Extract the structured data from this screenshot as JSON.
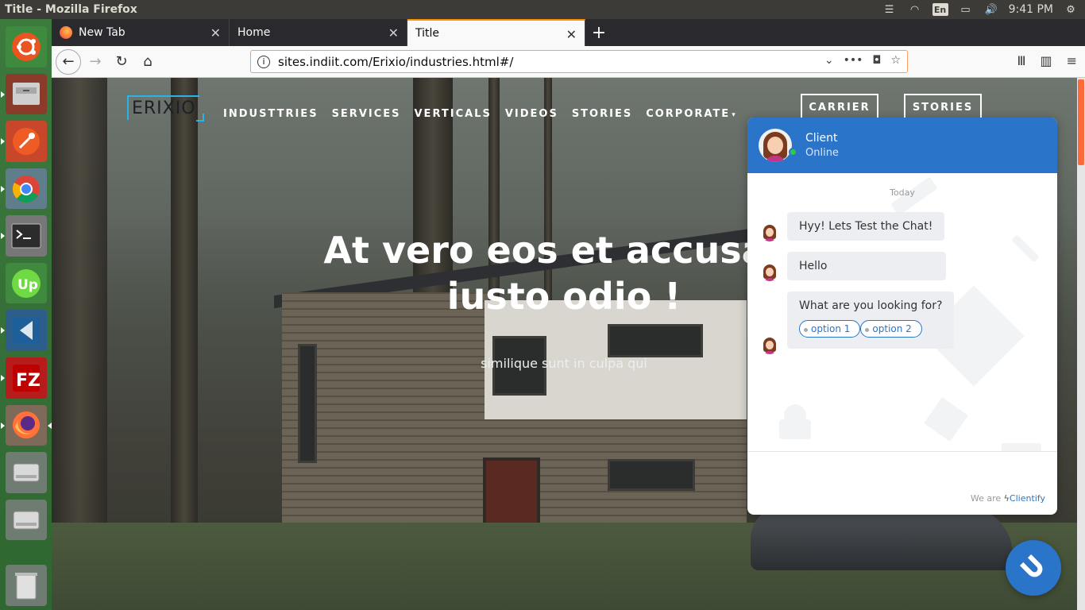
{
  "os": {
    "window_title": "Title - Mozilla Firefox",
    "keyboard_layout": "En",
    "clock": "9:41 PM"
  },
  "launcher": {
    "apps": [
      "ubuntu-dash-icon",
      "files-icon",
      "postman-icon",
      "chrome-icon",
      "terminal-icon",
      "upwork-icon",
      "vscode-icon",
      "filezilla-icon",
      "firefox-icon",
      "drive-icon",
      "drive-icon",
      "trash-icon"
    ]
  },
  "browser": {
    "tabs": [
      {
        "label": "New Tab"
      },
      {
        "label": "Home"
      },
      {
        "label": "Title"
      }
    ],
    "url": "sites.indiit.com/Erixio/industries.html#/"
  },
  "site": {
    "logo": "ERIXIO",
    "nav": [
      "INDUSTTRIES",
      "SERVICES",
      "VERTICALS",
      "VIDEOS",
      "STORIES",
      "CORPORATE"
    ],
    "carrier_btn": "CARRIER",
    "stories_btn": "STORIES",
    "hero_line1": "At vero eos et accusam",
    "hero_line2": "iusto odio !",
    "hero_sub": "similique sunt in culpa qui"
  },
  "chat": {
    "name": "Client",
    "status": "Online",
    "day_label": "Today",
    "messages": [
      {
        "text": "Hyy! Lets Test the Chat!"
      },
      {
        "text": "Hello"
      },
      {
        "text": "What are you looking for?"
      }
    ],
    "options": [
      "option 1",
      "option 2"
    ],
    "powered_prefix": "We are",
    "powered_brand": "Clientify"
  },
  "colors": {
    "chat_accent": "#2a74c9",
    "launcher_bg": "#3d7a3e",
    "tab_active_border": "#ff9400"
  }
}
